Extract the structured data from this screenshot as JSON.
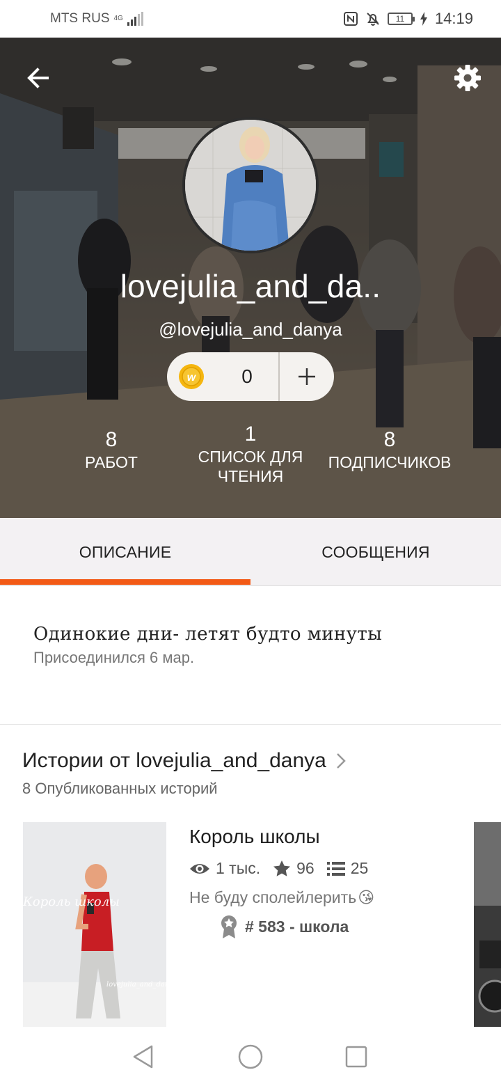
{
  "status_bar": {
    "carrier": "MTS RUS",
    "network": "4G",
    "battery": "11",
    "time": "14:19"
  },
  "profile": {
    "display_name": "lovejulia_and_da..",
    "handle": "@lovejulia_and_danya",
    "coins": "0",
    "stats": [
      {
        "value": "8",
        "label": "РАБОТ"
      },
      {
        "value": "1",
        "label": "СПИСОК ДЛЯ ЧТЕНИЯ"
      },
      {
        "value": "8",
        "label": "ПОДПИСЧИКОВ"
      }
    ]
  },
  "tabs": [
    {
      "label": "ОПИСАНИЕ",
      "active": true
    },
    {
      "label": "СООБЩЕНИЯ",
      "active": false
    }
  ],
  "about": {
    "bio": "Одинокие дни- летят будто минуты",
    "joined": "Присоединился 6 мар."
  },
  "stories": {
    "title": "Истории от lovejulia_and_danya",
    "subtitle": "8 Опубликованных историй",
    "items": [
      {
        "title": "Король школы",
        "views": "1 тыс.",
        "votes": "96",
        "parts": "25",
        "description": "Не буду сполейлерить",
        "emoji": "😘",
        "rank": "# 583 - школа",
        "cover_text": "Король школы",
        "cover_signature": "lovejulia_and_danya"
      }
    ]
  },
  "icons": {
    "back": "arrow-left-icon",
    "settings": "gear-icon",
    "coin": "coin-w-icon",
    "add": "plus-icon",
    "views": "eye-icon",
    "votes": "star-icon",
    "parts": "list-icon",
    "rank": "award-ribbon-icon",
    "chevron": "chevron-right-icon"
  },
  "colors": {
    "accent": "#f25a16",
    "coin": "#f5b60f",
    "tab_bg": "#f3f1f3"
  }
}
